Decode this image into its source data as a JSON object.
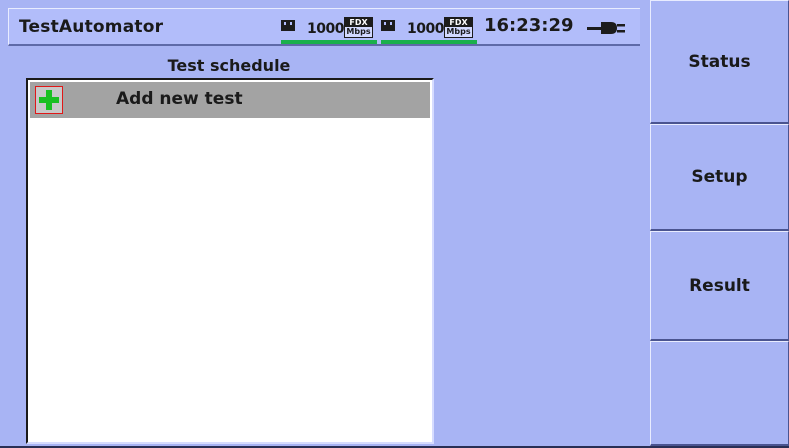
{
  "titlebar": {
    "app_title": "TestAutomator",
    "port1": {
      "speed": "1000",
      "duplex": "FDX",
      "unit": "Mbps",
      "link_color": "#19b04c"
    },
    "port2": {
      "speed": "1000",
      "duplex": "FDX",
      "unit": "Mbps",
      "link_color": "#19b04c"
    },
    "clock": "16:23:29",
    "power_icon": "ac-power-plug-icon"
  },
  "schedule": {
    "title": "Test schedule",
    "items": [
      {
        "label": "Add new test",
        "icon": "plus-icon",
        "selected": true
      }
    ]
  },
  "softkeys": [
    {
      "label": "Status"
    },
    {
      "label": "Setup"
    },
    {
      "label": "Result"
    },
    {
      "label": ""
    }
  ],
  "colors": {
    "background": "#a8b4f4",
    "selected_row": "#a3a3a3",
    "plus_green": "#19c020",
    "plus_border": "#e01818"
  }
}
